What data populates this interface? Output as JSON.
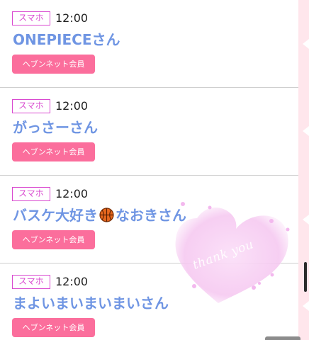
{
  "entries": [
    {
      "device": "スマホ",
      "time": "12:00",
      "name": "ONEPIECEさん",
      "member_label": "ヘブンネット会員"
    },
    {
      "device": "スマホ",
      "time": "12:00",
      "name": "がっさーさん",
      "member_label": "ヘブンネット会員"
    },
    {
      "device": "スマホ",
      "time": "12:00",
      "name_before": "バスケ大好き",
      "name_icon": "basketball-icon",
      "name_after": "なおきさん",
      "member_label": "ヘブンネット会員"
    },
    {
      "device": "スマホ",
      "time": "12:00",
      "name": "まよいまいまいまいさん",
      "member_label": "ヘブンネット会員"
    }
  ],
  "decoration": {
    "heart_text": "thank you",
    "heart_color": "#f5c6f0"
  },
  "colors": {
    "badge": "#d94ad0",
    "name": "#6f95e3",
    "button": "#fb6e9c",
    "rail": "#ffe6ec"
  }
}
